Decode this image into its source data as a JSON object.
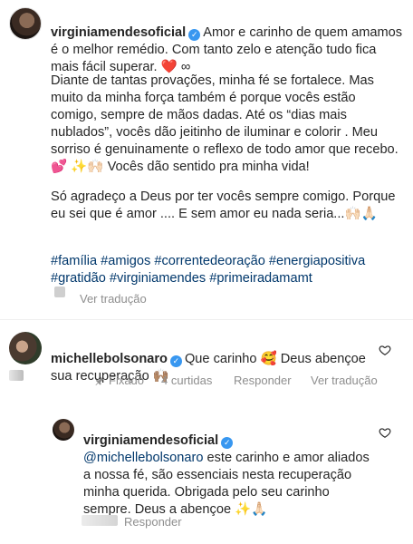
{
  "post": {
    "username": "virginiamendesoficial",
    "paragraph1": "Amor e carinho de quem amamos é o melhor remédio. Com tanto zelo e atenção tudo fica mais fácil superar. ❤️ ∞",
    "paragraph2": "Diante de tantas provações, minha fé se fortalece. Mas muito da minha força também é porque vocês estão comigo, sempre de mãos dadas.  Até os “dias mais nublados”, vocês dão jeitinho de iluminar e colorir . Meu sorriso é genuinamente o reflexo de todo amor que recebo. 💕 ✨🙌🏻 Vocês dão sentido pra minha vida!",
    "paragraph3": "Só agradeço a Deus por ter vocês sempre comigo. Porque eu sei que é amor .... E sem amor eu nada seria...🙌🏻🙏🏻",
    "hashtags": "#família #amigos #correntedeoração #energiapositiva #gratidão #virginiamendes #primeiradamamt",
    "translate": "Ver tradução"
  },
  "comment": {
    "username": "michellebolsonaro",
    "text": "Que carinho 🥰 Deus abençoe sua recuperação 🙌🏽",
    "pinned": "Fixado",
    "likes": "4 curtidas",
    "reply": "Responder",
    "translate": "Ver tradução"
  },
  "reply": {
    "username": "virginiamendesoficial",
    "mention": "@michellebolsonaro",
    "text": " este carinho e amor aliados a nossa fé, são essenciais nesta recuperação minha querida. Obrigada pelo seu carinho sempre. Deus a abençoe ✨🙏🏻",
    "reply": "Responder"
  },
  "colors": {
    "link": "#00376b",
    "verified": "#3897f0",
    "meta": "#8e8e8e"
  },
  "icons": [
    "heart-icon",
    "pin-icon",
    "verified-icon"
  ]
}
